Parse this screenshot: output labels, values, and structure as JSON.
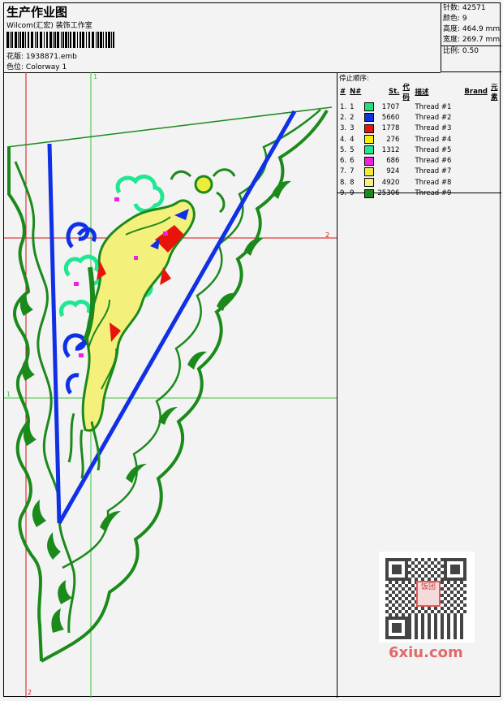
{
  "header": {
    "title": "生产作业图",
    "subtitle": "Wilcom(汇宏) 装饰工作室",
    "design_label": "花版:",
    "design_value": "1938871.emb",
    "colorway_label": "色位:",
    "colorway_value": "Colorway 1"
  },
  "stats": {
    "stitches_label": "针数:",
    "stitches_value": "42571",
    "colors_label": "颜色:",
    "colors_value": "9",
    "height_label": "高度:",
    "height_value": "464.9 mm",
    "width_label": "宽度:",
    "width_value": "269.7 mm",
    "scale_label": "比例:",
    "scale_value": "0.50"
  },
  "thread_panel": {
    "caption": "停止顺序:",
    "headers": {
      "hash": "#",
      "n": "N#",
      "st": "St.",
      "code": "代码",
      "desc": "描述",
      "brand": "Brand",
      "elem": "元素"
    },
    "threads": [
      {
        "idx": "1.",
        "n": "1",
        "st": "1707",
        "desc": "Thread #1",
        "color": "#22e07a"
      },
      {
        "idx": "2.",
        "n": "2",
        "st": "5660",
        "desc": "Thread #2",
        "color": "#1030e6"
      },
      {
        "idx": "3.",
        "n": "3",
        "st": "1778",
        "desc": "Thread #3",
        "color": "#e8140c"
      },
      {
        "idx": "4.",
        "n": "4",
        "st": "276",
        "desc": "Thread #4",
        "color": "#f6f000"
      },
      {
        "idx": "5.",
        "n": "5",
        "st": "1312",
        "desc": "Thread #5",
        "color": "#20e892"
      },
      {
        "idx": "6.",
        "n": "6",
        "st": "686",
        "desc": "Thread #6",
        "color": "#f020e0"
      },
      {
        "idx": "7.",
        "n": "7",
        "st": "924",
        "desc": "Thread #7",
        "color": "#ecec3a"
      },
      {
        "idx": "8.",
        "n": "8",
        "st": "4920",
        "desc": "Thread #8",
        "color": "#f4f07c"
      },
      {
        "idx": "9.",
        "n": "9",
        "st": "25306",
        "desc": "Thread #9",
        "color": "#1b8a1b"
      }
    ]
  },
  "guides": {
    "v1": "1",
    "h2": "2",
    "h1": "1",
    "v2": "2"
  },
  "watermark": {
    "text": "6xiu.com",
    "stamp": "饭团"
  },
  "colors": {
    "green": "#1b8a1b",
    "blue": "#1030e6",
    "red": "#e8140c",
    "guide_green": "#3ec23e",
    "guide_red": "#d81010"
  }
}
